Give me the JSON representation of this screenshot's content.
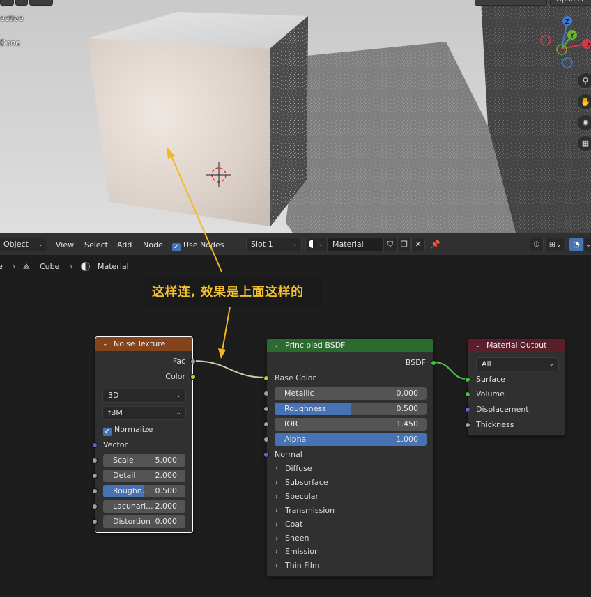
{
  "viewport": {
    "overlay_lines": [
      "ective",
      "Done"
    ],
    "top_right_button": "Options",
    "gizmo": {
      "z": "Z",
      "y": "Y",
      "x": "X"
    }
  },
  "header": {
    "mode": "Object",
    "menu": [
      "View",
      "Select",
      "Add",
      "Node"
    ],
    "use_nodes_label": "Use Nodes",
    "use_nodes_checked": true,
    "slot": "Slot 1",
    "material_name": "Material"
  },
  "breadcrumb": {
    "items": [
      "e",
      "Cube",
      "Material"
    ]
  },
  "annotation": {
    "text": "这样连, 效果是上面这样的"
  },
  "nodes": {
    "noise": {
      "title": "Noise Texture",
      "header_color": "#83431d",
      "outputs": [
        "Fac",
        "Color"
      ],
      "dimensions": "3D",
      "type": "fBM",
      "normalize_label": "Normalize",
      "vector_label": "Vector",
      "fields": [
        {
          "label": "Scale",
          "value": "5.000",
          "fill": 0
        },
        {
          "label": "Detail",
          "value": "2.000",
          "fill": 0
        },
        {
          "label": "Roughn...",
          "value": "0.500",
          "fill": 0.5
        },
        {
          "label": "Lacunari...",
          "value": "2.000",
          "fill": 0
        },
        {
          "label": "Distortion",
          "value": "0.000",
          "fill": 0
        }
      ]
    },
    "bsdf": {
      "title": "Principled BSDF",
      "header_color": "#2c6b30",
      "output": "BSDF",
      "base_color_label": "Base Color",
      "fields": [
        {
          "label": "Metallic",
          "value": "0.000",
          "fill": 0
        },
        {
          "label": "Roughness",
          "value": "0.500",
          "fill": 0.5
        },
        {
          "label": "IOR",
          "value": "1.450",
          "fill": 0
        },
        {
          "label": "Alpha",
          "value": "1.000",
          "fill": 1
        }
      ],
      "normal_label": "Normal",
      "panels": [
        "Diffuse",
        "Subsurface",
        "Specular",
        "Transmission",
        "Coat",
        "Sheen",
        "Emission",
        "Thin Film"
      ]
    },
    "output": {
      "title": "Material Output",
      "header_color": "#5b1f2b",
      "target": "All",
      "inputs": [
        "Surface",
        "Volume",
        "Displacement",
        "Thickness"
      ]
    }
  },
  "colors": {
    "accent_blue": "#4772b3",
    "annotation_text": "#f3c130",
    "arrow": "#f2b824",
    "link_shader": "#4ec24e",
    "link_float": "#cfcfa8"
  }
}
